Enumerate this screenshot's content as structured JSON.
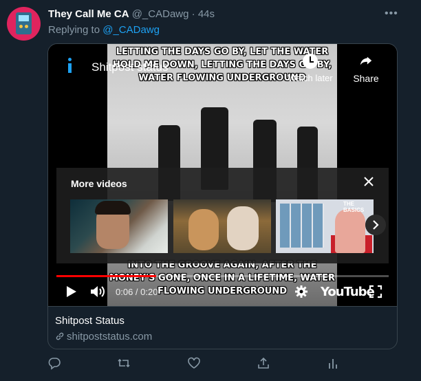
{
  "tweet": {
    "display_name": "They Call Me CA",
    "handle": "@_CADawg",
    "separator": "·",
    "time": "44s",
    "reply_prefix": "Replying to",
    "reply_to": "@_CADawg",
    "more_glyph": "•••"
  },
  "video": {
    "title": "Shitpost status",
    "watch_later_label": "Watch later",
    "share_label": "Share",
    "caption_top": "LETTING THE DAYS GO BY, LET THE WATER HOLD ME DOWN, LETTING THE DAYS GO BY, WATER FLOWING UNDERGROUND",
    "caption_bottom": "INTO THE GROOVE AGAIN, AFTER THE MONEY'S GONE, ONCE IN A LIFETIME, WATER FLOWING UNDERGROUND",
    "more_videos_label": "More videos",
    "thumb3_text": "THE BASICS",
    "time_readout": "0:06 / 0:20",
    "progress": 0.3,
    "brand": "YouTube",
    "accent": "#ff0000"
  },
  "card": {
    "title": "Shitpost Status",
    "domain": "shitpoststatus.com"
  },
  "colors": {
    "background": "#15202b",
    "link": "#1da1f2",
    "muted": "#8899a6",
    "border": "#38444d"
  }
}
